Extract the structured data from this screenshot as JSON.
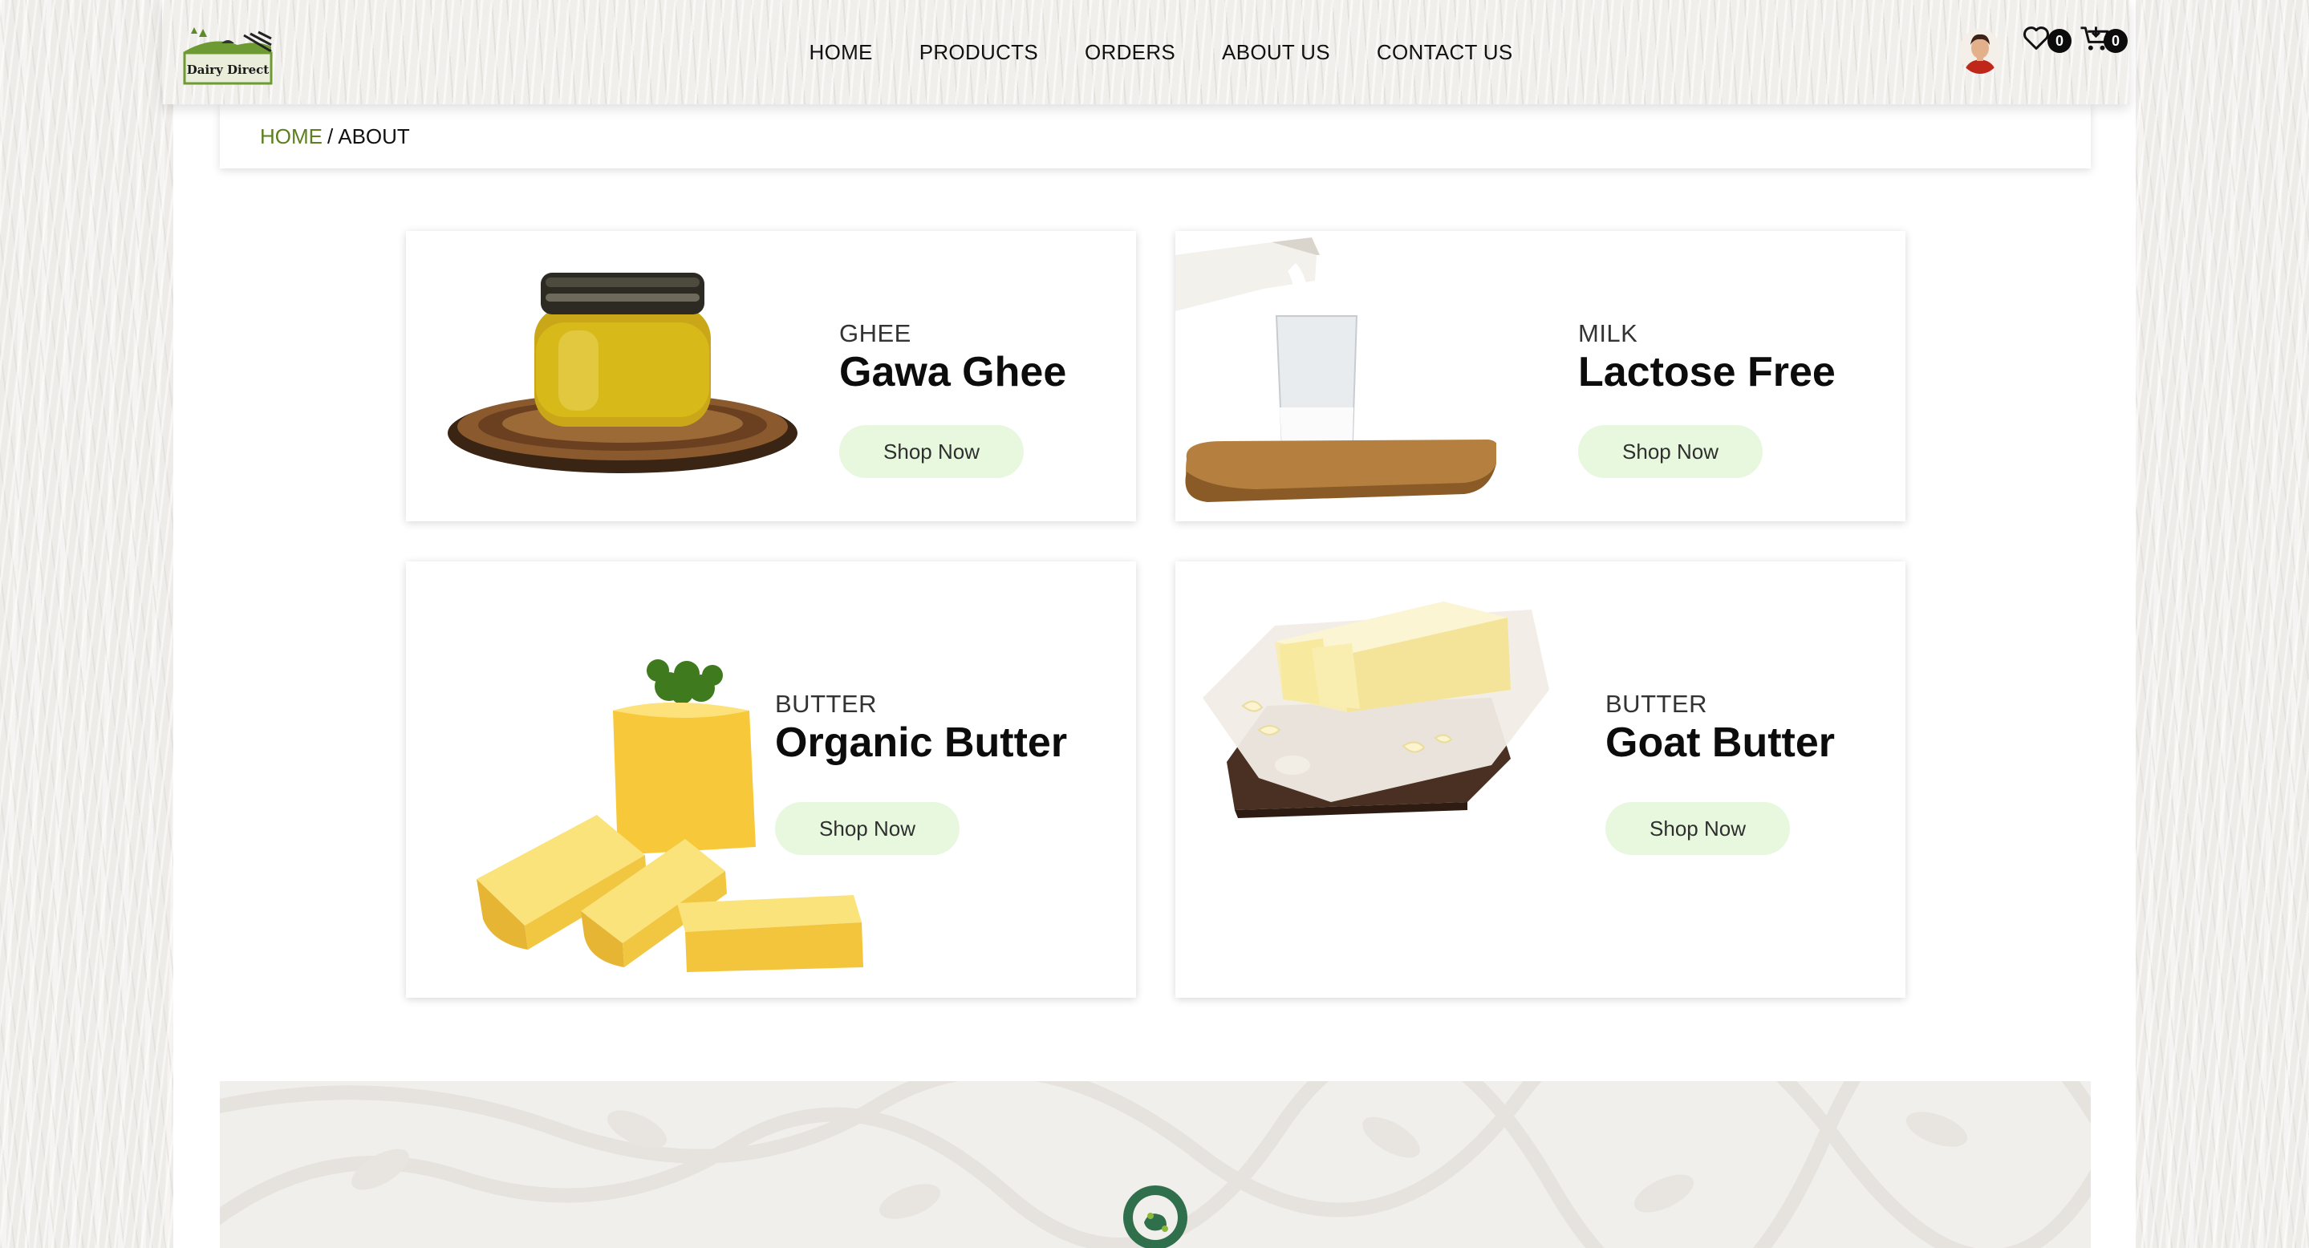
{
  "brand": {
    "logo_text": "Dairy Direct"
  },
  "nav": {
    "items": [
      {
        "label": "HOME",
        "name": "nav-home"
      },
      {
        "label": "PRODUCTS",
        "name": "nav-products"
      },
      {
        "label": "ORDERS",
        "name": "nav-orders"
      },
      {
        "label": "ABOUT US",
        "name": "nav-about-us"
      },
      {
        "label": "CONTACT US",
        "name": "nav-contact-us"
      }
    ],
    "wishlist_count": "0",
    "cart_count": "0"
  },
  "breadcrumb": {
    "home": "HOME",
    "separator": "/",
    "current": "ABOUT"
  },
  "products": [
    {
      "category": "GHEE",
      "title": "Gawa Ghee",
      "button": "Shop Now",
      "image": "ghee-jar-image"
    },
    {
      "category": "MILK",
      "title": "Lactose Free",
      "button": "Shop Now",
      "image": "milk-glass-image"
    },
    {
      "category": "BUTTER",
      "title": "Organic Butter",
      "button": "Shop Now",
      "image": "butter-blocks-image"
    },
    {
      "category": "BUTTER",
      "title": "Goat Butter",
      "button": "Shop Now",
      "image": "goat-butter-image"
    }
  ],
  "colors": {
    "accent_green": "#5d7f1e",
    "button_bg": "#e8f8de",
    "badge_bg": "#0c0c0c"
  }
}
